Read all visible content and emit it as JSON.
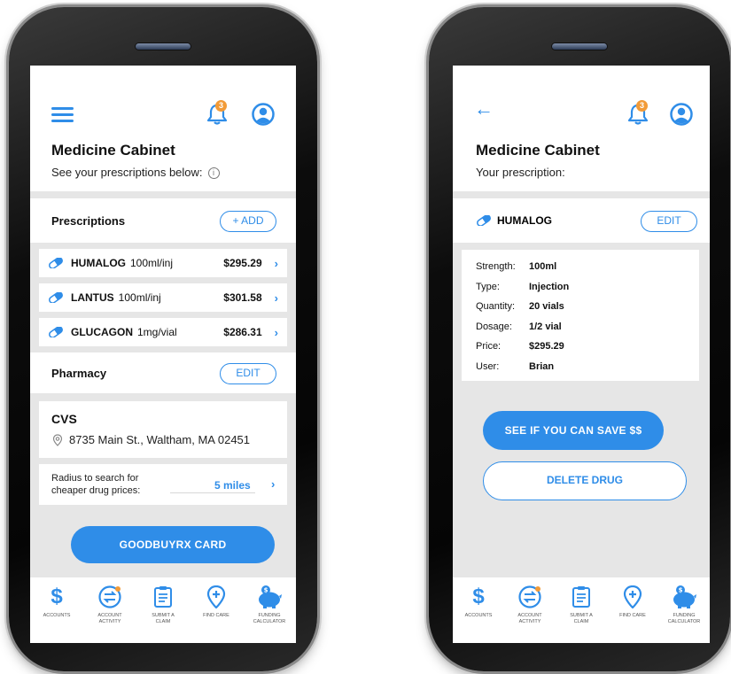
{
  "colors": {
    "accent": "#2f8de8",
    "badge": "#f29b38",
    "screen_bg": "#e6e6e6"
  },
  "left_screen": {
    "header": {
      "menu_icon": "hamburger-icon",
      "bell_icon": "bell-icon",
      "badge_count": "3",
      "profile_icon": "user-icon"
    },
    "title": "Medicine Cabinet",
    "subtitle": "See your prescriptions below:",
    "info_icon": "i",
    "prescriptions": {
      "title": "Prescriptions",
      "add_label": "+ ADD",
      "items": [
        {
          "name": "HUMALOG",
          "dose": "100ml/inj",
          "price": "$295.29"
        },
        {
          "name": "LANTUS",
          "dose": "100ml/inj",
          "price": "$301.58"
        },
        {
          "name": "GLUCAGON",
          "dose": "1mg/vial",
          "price": "$286.31"
        }
      ]
    },
    "pharmacy": {
      "title": "Pharmacy",
      "edit_label": "EDIT",
      "name": "CVS",
      "address": "8735 Main St., Waltham, MA 02451"
    },
    "radius": {
      "label_line1": "Radius to search for",
      "label_line2": "cheaper drug prices:",
      "value": "5 miles"
    },
    "card_button": "GOODBUYRX CARD"
  },
  "right_screen": {
    "header": {
      "back_icon": "back-arrow-icon",
      "bell_icon": "bell-icon",
      "badge_count": "3",
      "profile_icon": "user-icon"
    },
    "title": "Medicine Cabinet",
    "subtitle": "Your prescription:",
    "drug_name": "HUMALOG",
    "edit_label": "EDIT",
    "details": [
      {
        "key": "Strength:",
        "value": "100ml"
      },
      {
        "key": "Type:",
        "value": "Injection"
      },
      {
        "key": "Quantity:",
        "value": "20 vials"
      },
      {
        "key": "Dosage:",
        "value": "1/2 vial"
      },
      {
        "key": "Price:",
        "value": "$295.29"
      },
      {
        "key": "User:",
        "value": "Brian"
      }
    ],
    "save_button": "SEE IF YOU CAN SAVE $$",
    "delete_button": "DELETE DRUG"
  },
  "bottom_nav": [
    {
      "label1": "ACCOUNTS",
      "label2": "",
      "icon": "dollar-icon"
    },
    {
      "label1": "ACCOUNT",
      "label2": "ACTIVITY",
      "icon": "transfer-icon"
    },
    {
      "label1": "SUBMIT A",
      "label2": "CLAIM",
      "icon": "clipboard-icon"
    },
    {
      "label1": "FIND CARE",
      "label2": "",
      "icon": "location-plus-icon"
    },
    {
      "label1": "FUNDING",
      "label2": "CALCULATOR",
      "icon": "piggy-bank-icon"
    }
  ]
}
